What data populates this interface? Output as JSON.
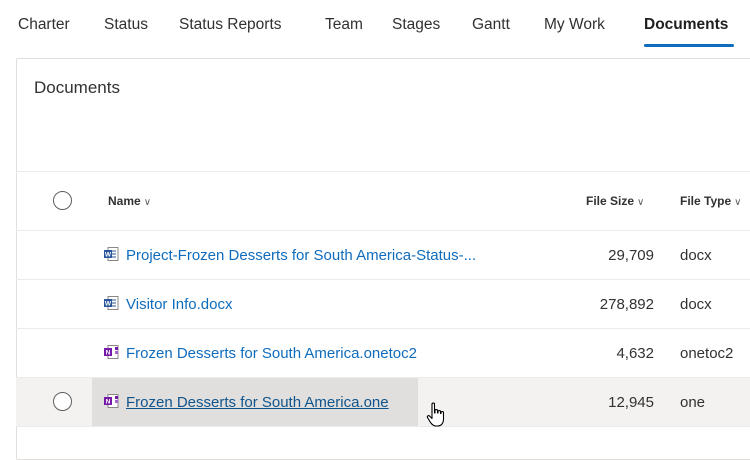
{
  "tabs": [
    {
      "label": "Charter"
    },
    {
      "label": "Status"
    },
    {
      "label": "Status Reports"
    },
    {
      "label": "Team"
    },
    {
      "label": "Stages"
    },
    {
      "label": "Gantt"
    },
    {
      "label": "My Work"
    },
    {
      "label": "Documents",
      "active": true
    }
  ],
  "card": {
    "title": "Documents"
  },
  "columns": {
    "name": "Name",
    "file_size": "File Size",
    "file_type": "File Type"
  },
  "rows": [
    {
      "name": "Project-Frozen Desserts for South America-Status-...",
      "size": "29,709",
      "type": "docx",
      "icon": "word-doc-icon"
    },
    {
      "name": "Visitor Info.docx",
      "size": "278,892",
      "type": "docx",
      "icon": "word-doc-icon"
    },
    {
      "name": "Frozen Desserts for South America.onetoc2",
      "size": "4,632",
      "type": "onetoc2",
      "icon": "onenote-icon"
    },
    {
      "name": "Frozen Desserts for South America.one",
      "size": "12,945",
      "type": "one",
      "icon": "onenote-icon"
    }
  ],
  "colors": {
    "accent": "#0f6cbd",
    "word": "#2b579a",
    "onenote": "#7719aa"
  }
}
